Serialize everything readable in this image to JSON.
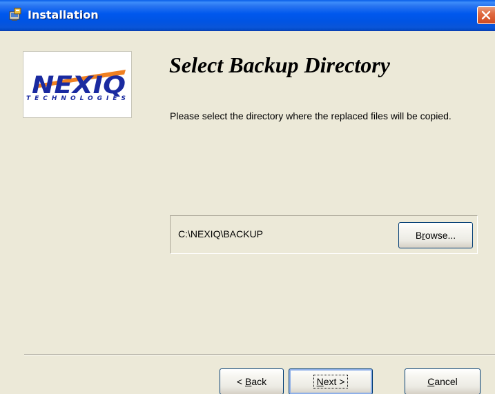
{
  "window": {
    "title": "Installation"
  },
  "logo": {
    "brand": "NEXIQ",
    "tagline": "TECHNOLOGIES",
    "colors": {
      "brand_blue": "#1a2aa0",
      "accent_orange": "#f08020"
    }
  },
  "page": {
    "title": "Select Backup Directory",
    "instruction": "Please select the directory where the replaced files will be copied."
  },
  "backup": {
    "path": "C:\\NEXIQ\\BACKUP",
    "browse": {
      "mnemonic": "r",
      "pre": "B",
      "post": "owse..."
    }
  },
  "nav": {
    "back": {
      "pre": "< ",
      "mnemonic": "B",
      "post": "ack"
    },
    "next": {
      "pre": "",
      "mnemonic": "N",
      "post": "ext >"
    },
    "cancel": {
      "pre": "",
      "mnemonic": "C",
      "post": "ancel"
    }
  },
  "icons": {
    "app": "installer-icon",
    "close": "close-icon"
  }
}
